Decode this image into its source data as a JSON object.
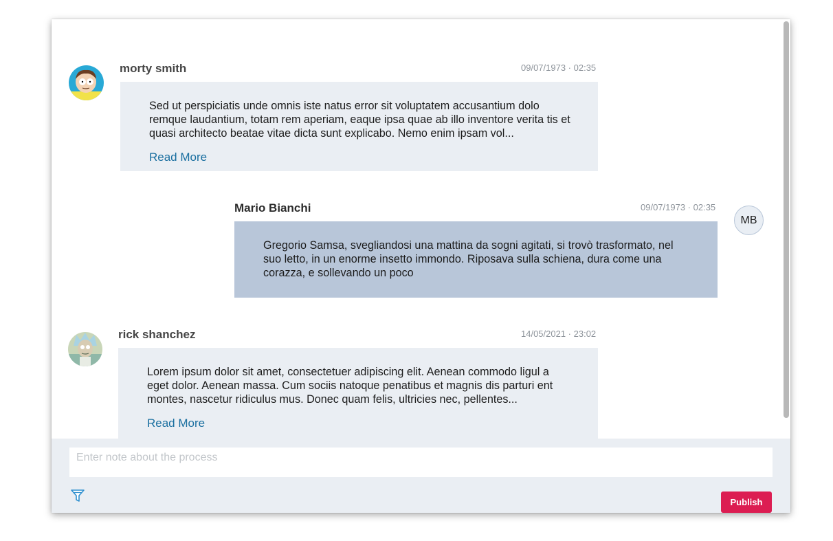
{
  "messages": [
    {
      "author": "morty smith",
      "timestamp": "09/07/1973 · 02:35",
      "text": "Sed ut perspiciatis unde omnis iste natus error sit voluptatem accusantium dolo remque laudantium, totam rem aperiam, eaque ipsa quae ab illo inventore verita tis et quasi architecto beatae vitae dicta sunt explicabo. Nemo enim ipsam vol...",
      "read_more": "Read More",
      "avatar_icon": "morty-avatar-icon"
    },
    {
      "author": "Mario Bianchi",
      "timestamp": "09/07/1973 · 02:35",
      "text": "Gregorio Samsa, svegliandosi una mattina da sogni agitati, si trovò trasformato, nel suo letto, in un enorme insetto immondo. Riposava sulla schiena, dura come una corazza, e sollevando un poco",
      "avatar_initials": "MB"
    },
    {
      "author": "rick shanchez",
      "timestamp": "14/05/2021 · 23:02",
      "text": "Lorem ipsum dolor sit amet, consectetuer adipiscing elit. Aenean commodo ligul a eget dolor. Aenean massa. Cum sociis natoque penatibus et magnis dis parturi ent montes, nascetur ridiculus mus. Donec quam felis, ultricies nec, pellentes...",
      "read_more": "Read More",
      "avatar_icon": "rick-avatar-icon"
    }
  ],
  "composer": {
    "placeholder": "Enter note about the process",
    "publish_label": "Publish",
    "filter_icon": "filter-icon"
  },
  "colors": {
    "accent": "#dc1d52",
    "link": "#1a6fa0",
    "bubble_received": "#eaeef3",
    "bubble_sent": "#b8c6d9"
  }
}
